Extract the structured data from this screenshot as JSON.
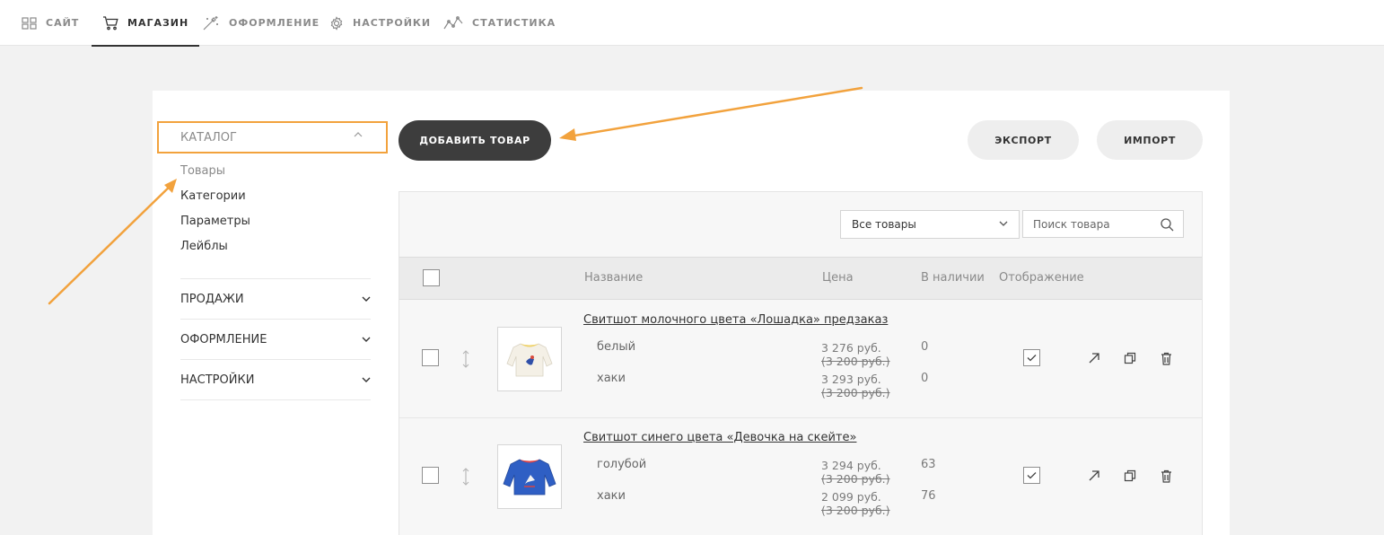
{
  "topnav": {
    "items": [
      {
        "label": "САЙТ",
        "icon": "grid-icon"
      },
      {
        "label": "МАГАЗИН",
        "icon": "cart-icon",
        "active": true
      },
      {
        "label": "ОФОРМЛЕНИЕ",
        "icon": "magic-wand-icon"
      },
      {
        "label": "НАСТРОЙКИ",
        "icon": "gear-icon"
      },
      {
        "label": "СТАТИСТИКА",
        "icon": "chart-line-icon"
      }
    ]
  },
  "sidebar": {
    "catalog_label": "КАТАЛОГ",
    "catalog_links": [
      "Товары",
      "Категории",
      "Параметры",
      "Лейблы"
    ],
    "sections": [
      "ПРОДАЖИ",
      "ОФОРМЛЕНИЕ",
      "НАСТРОЙКИ"
    ]
  },
  "toolbar": {
    "add_label": "ДОБАВИТЬ ТОВАР",
    "export_label": "ЭКСПОРТ",
    "import_label": "ИМПОРТ"
  },
  "filter": {
    "selected": "Все товары",
    "search_placeholder": "Поиск товара"
  },
  "table": {
    "headers": {
      "name": "Название",
      "price": "Цена",
      "stock": "В наличии",
      "visibility": "Отображение"
    },
    "rows": [
      {
        "title": "Свитшот молочного цвета «Лошадка» предзаказ",
        "image": "sweatshirt-cream-horse",
        "variants": [
          {
            "name": "белый",
            "price": "3 276 руб.",
            "old_price": "(3 200 руб.)",
            "stock": "0"
          },
          {
            "name": "хаки",
            "price": "3 293 руб.",
            "old_price": "(3 200 руб.)",
            "stock": "0"
          }
        ]
      },
      {
        "title": "Свитшот синего цвета «Девочка на скейте»",
        "image": "sweatshirt-blue-skater",
        "variants": [
          {
            "name": "голубой",
            "price": "3 294 руб.",
            "old_price": "(3 200 руб.)",
            "stock": "63"
          },
          {
            "name": "хаки",
            "price": "2 099 руб.",
            "old_price": "(3 200 руб.)",
            "stock": "76"
          }
        ]
      }
    ]
  },
  "colors": {
    "highlight": "#f2a23d",
    "dark_button": "#3d3d3d",
    "light_button": "#eeeeee"
  }
}
